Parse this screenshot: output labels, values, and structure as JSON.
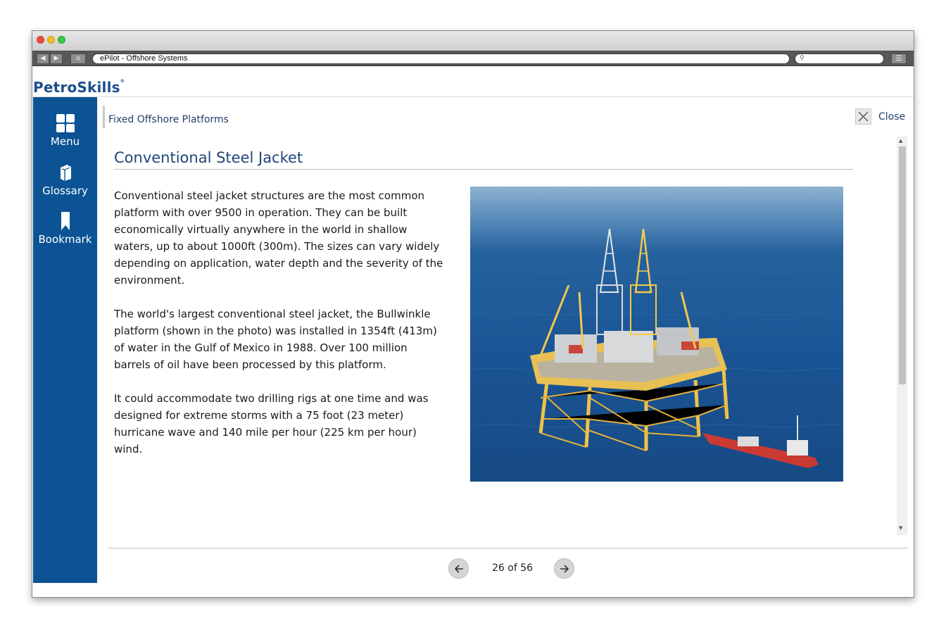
{
  "browser": {
    "tab_title": "ePilot - Offshore Systems",
    "search_placeholder": ""
  },
  "brand": {
    "logo_text": "PetroSkills",
    "color": "#1c4e8e"
  },
  "sidebar": {
    "background": "#0b5394",
    "items": [
      {
        "label": "Menu",
        "icon": "grid-icon"
      },
      {
        "label": "Glossary",
        "icon": "book-icon"
      },
      {
        "label": "Bookmark",
        "icon": "bookmark-icon"
      }
    ]
  },
  "content": {
    "breadcrumb": "Fixed Offshore Platforms",
    "close_label": "Close",
    "title": "Conventional Steel Jacket",
    "paragraphs": [
      "Conventional steel jacket structures are the most common platform with over 9500 in operation.  They can be built economically virtually anywhere in the world in shallow waters, up to about 1000ft (300m). The sizes can vary widely depending on application, water depth and the severity of the environment.",
      "The world's largest conventional steel jacket, the Bullwinkle platform (shown in the photo) was installed in 1354ft (413m) of water in the Gulf of Mexico in 1988. Over 100 million barrels of oil have been processed by this platform.",
      "It could accommodate two drilling rigs at one time and was designed for extreme storms with a 75 foot (23 meter) hurricane wave and 140 mile per hour (225 km per hour) wind."
    ]
  },
  "pagination": {
    "text": "26 of 56",
    "current": 26,
    "total": 56
  }
}
